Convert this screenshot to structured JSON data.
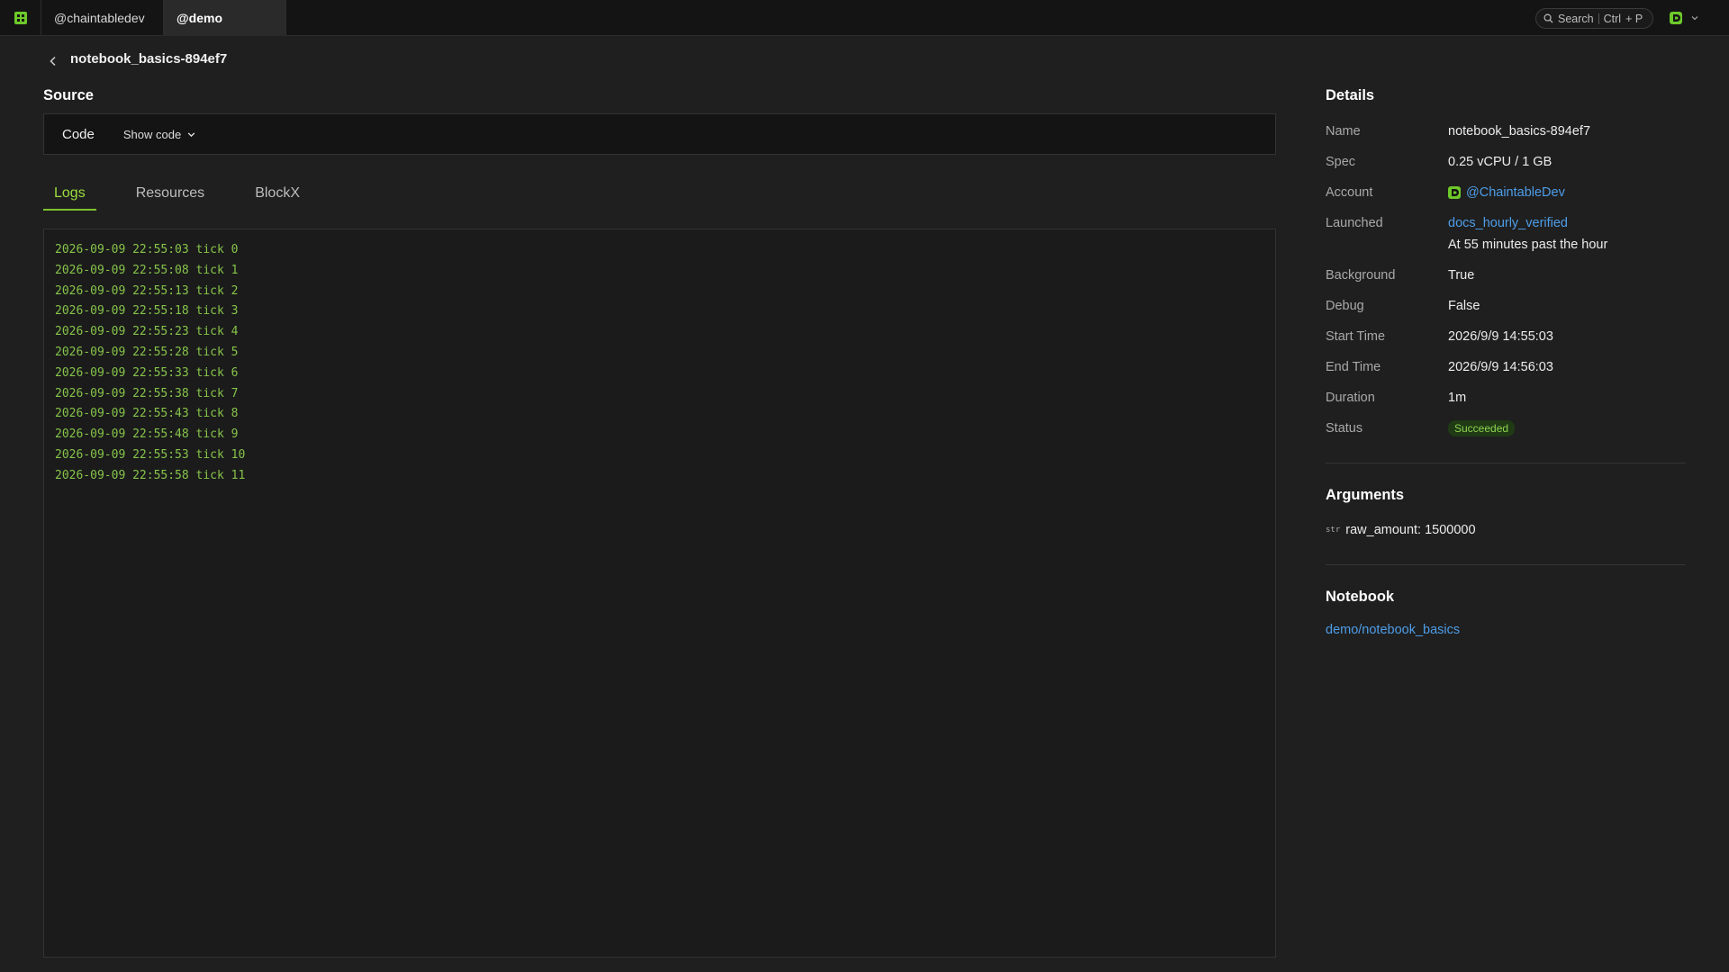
{
  "topbar": {
    "tabs": [
      "@chaintabledev",
      "@demo"
    ],
    "search": {
      "label": "Search",
      "key1": "Ctrl",
      "key2": "+ P"
    }
  },
  "header": {
    "title": "notebook_basics-894ef7"
  },
  "source": {
    "title": "Source",
    "code_label": "Code",
    "show_code_label": "Show code"
  },
  "tabs": [
    "Logs",
    "Resources",
    "BlockX"
  ],
  "logs": [
    "2026-09-09 22:55:03 tick 0",
    "2026-09-09 22:55:08 tick 1",
    "2026-09-09 22:55:13 tick 2",
    "2026-09-09 22:55:18 tick 3",
    "2026-09-09 22:55:23 tick 4",
    "2026-09-09 22:55:28 tick 5",
    "2026-09-09 22:55:33 tick 6",
    "2026-09-09 22:55:38 tick 7",
    "2026-09-09 22:55:43 tick 8",
    "2026-09-09 22:55:48 tick 9",
    "2026-09-09 22:55:53 tick 10",
    "2026-09-09 22:55:58 tick 11"
  ],
  "details": {
    "title": "Details",
    "name_key": "Name",
    "name": "notebook_basics-894ef7",
    "spec_key": "Spec",
    "spec": "0.25 vCPU / 1 GB",
    "account_key": "Account",
    "account": "@ChaintableDev",
    "launched_key": "Launched",
    "launched_link": "docs_hourly_verified",
    "launched_schedule": "At 55 minutes past the hour",
    "background_key": "Background",
    "background": "True",
    "debug_key": "Debug",
    "debug": "False",
    "start_key": "Start Time",
    "start": "2026/9/9 14:55:03",
    "end_key": "End Time",
    "end": "2026/9/9 14:56:03",
    "duration_key": "Duration",
    "duration": "1m",
    "status_key": "Status",
    "status": "Succeeded"
  },
  "arguments": {
    "title": "Arguments",
    "items": [
      {
        "type": "str",
        "text": "raw_amount: 1500000"
      }
    ]
  },
  "notebook": {
    "title": "Notebook",
    "link": "demo/notebook_basics"
  },
  "colors": {
    "accent_green": "#7fc22e",
    "link_blue": "#4d9de8",
    "log_green": "#86c44a",
    "background": "#1f1f1f"
  },
  "icons": [
    "app-logo-icon",
    "search-icon",
    "chevron-left-icon",
    "chevron-down-icon",
    "user-avatar-icon",
    "account-icon"
  ]
}
